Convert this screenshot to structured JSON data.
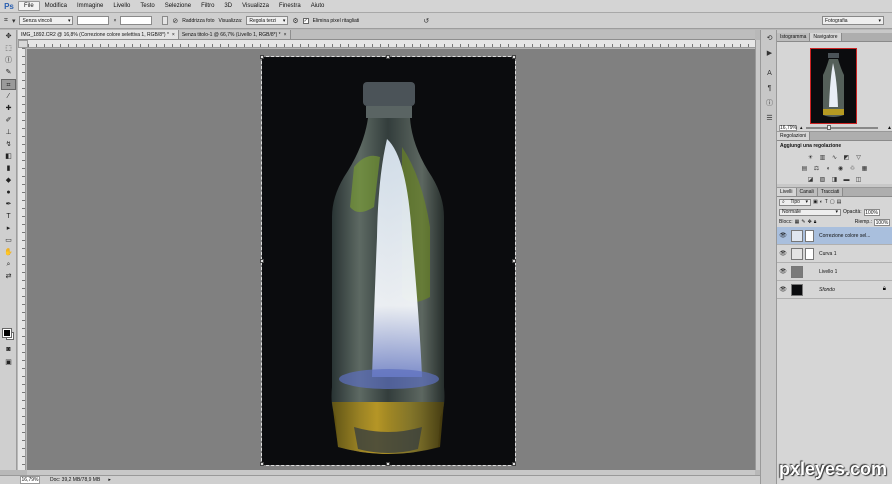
{
  "app": {
    "logo": "Ps"
  },
  "menu": [
    "File",
    "Modifica",
    "Immagine",
    "Livello",
    "Testo",
    "Selezione",
    "Filtro",
    "3D",
    "Visualizza",
    "Finestra",
    "Aiuto"
  ],
  "options": {
    "ratio": "Senza vincoli",
    "straighten": "Raddrizza foto",
    "view_label": "Visualizza:",
    "view_value": "Regola terzi",
    "delete_pixels": "Elimina pixel ritagliati",
    "swap_sep": "×"
  },
  "workspace": "Fotografia",
  "tabs": [
    {
      "label": "IMG_1892.CR2 @ 16,8% (Correzione colore selettiva 1, RGB/8*) *"
    },
    {
      "label": "Senza titolo-1 @ 66,7% (Livello 1, RGB/8*) *"
    }
  ],
  "status": {
    "zoom": "16,79%",
    "doc": "Doc: 39,2 MB/78,9 MB"
  },
  "navigator": {
    "tabs": [
      "Istogramma",
      "Navigatore"
    ],
    "zoom": "16,79%"
  },
  "adjustments": {
    "tabs": [
      "Regolazioni"
    ],
    "title": "Aggiungi una regolazione"
  },
  "layers": {
    "tabs": [
      "Livelli",
      "Canali",
      "Tracciati"
    ],
    "kind": "Tipo",
    "blend": "Normale",
    "opacity_label": "Opacità:",
    "opacity": "100%",
    "lock_label": "Blocc:",
    "fill_label": "Riemp.:",
    "fill": "100%",
    "items": [
      {
        "name": "Correzione colore sel...",
        "active": true
      },
      {
        "name": "Curva 1"
      },
      {
        "name": "Livello 1"
      },
      {
        "name": "Sfondo"
      }
    ]
  },
  "watermark": "pxleyes.com",
  "colors": {
    "accent": "#a9bfdd",
    "canvas": "#0b0c0e",
    "pasteboard": "#808080"
  },
  "icons": [
    "crop-icon",
    "move-icon",
    "marquee-icon",
    "lasso-icon",
    "brush-icon",
    "eye-icon",
    "lock-icon"
  ]
}
